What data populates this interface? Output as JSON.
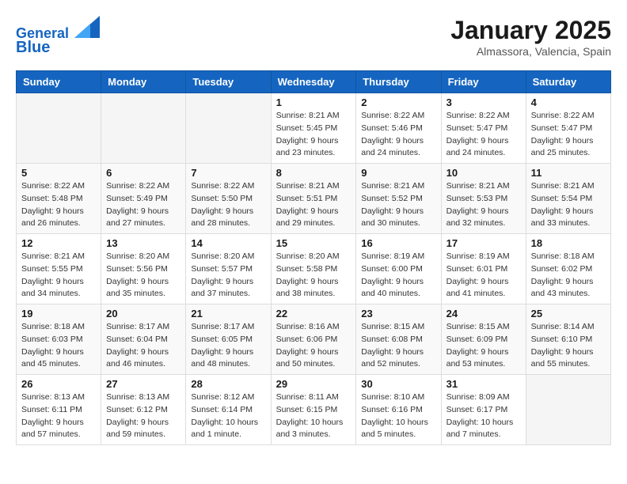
{
  "header": {
    "logo_line1": "General",
    "logo_line2": "Blue",
    "month_title": "January 2025",
    "location": "Almassora, Valencia, Spain"
  },
  "weekdays": [
    "Sunday",
    "Monday",
    "Tuesday",
    "Wednesday",
    "Thursday",
    "Friday",
    "Saturday"
  ],
  "weeks": [
    [
      {
        "day": "",
        "info": ""
      },
      {
        "day": "",
        "info": ""
      },
      {
        "day": "",
        "info": ""
      },
      {
        "day": "1",
        "info": "Sunrise: 8:21 AM\nSunset: 5:45 PM\nDaylight: 9 hours\nand 23 minutes."
      },
      {
        "day": "2",
        "info": "Sunrise: 8:22 AM\nSunset: 5:46 PM\nDaylight: 9 hours\nand 24 minutes."
      },
      {
        "day": "3",
        "info": "Sunrise: 8:22 AM\nSunset: 5:47 PM\nDaylight: 9 hours\nand 24 minutes."
      },
      {
        "day": "4",
        "info": "Sunrise: 8:22 AM\nSunset: 5:47 PM\nDaylight: 9 hours\nand 25 minutes."
      }
    ],
    [
      {
        "day": "5",
        "info": "Sunrise: 8:22 AM\nSunset: 5:48 PM\nDaylight: 9 hours\nand 26 minutes."
      },
      {
        "day": "6",
        "info": "Sunrise: 8:22 AM\nSunset: 5:49 PM\nDaylight: 9 hours\nand 27 minutes."
      },
      {
        "day": "7",
        "info": "Sunrise: 8:22 AM\nSunset: 5:50 PM\nDaylight: 9 hours\nand 28 minutes."
      },
      {
        "day": "8",
        "info": "Sunrise: 8:21 AM\nSunset: 5:51 PM\nDaylight: 9 hours\nand 29 minutes."
      },
      {
        "day": "9",
        "info": "Sunrise: 8:21 AM\nSunset: 5:52 PM\nDaylight: 9 hours\nand 30 minutes."
      },
      {
        "day": "10",
        "info": "Sunrise: 8:21 AM\nSunset: 5:53 PM\nDaylight: 9 hours\nand 32 minutes."
      },
      {
        "day": "11",
        "info": "Sunrise: 8:21 AM\nSunset: 5:54 PM\nDaylight: 9 hours\nand 33 minutes."
      }
    ],
    [
      {
        "day": "12",
        "info": "Sunrise: 8:21 AM\nSunset: 5:55 PM\nDaylight: 9 hours\nand 34 minutes."
      },
      {
        "day": "13",
        "info": "Sunrise: 8:20 AM\nSunset: 5:56 PM\nDaylight: 9 hours\nand 35 minutes."
      },
      {
        "day": "14",
        "info": "Sunrise: 8:20 AM\nSunset: 5:57 PM\nDaylight: 9 hours\nand 37 minutes."
      },
      {
        "day": "15",
        "info": "Sunrise: 8:20 AM\nSunset: 5:58 PM\nDaylight: 9 hours\nand 38 minutes."
      },
      {
        "day": "16",
        "info": "Sunrise: 8:19 AM\nSunset: 6:00 PM\nDaylight: 9 hours\nand 40 minutes."
      },
      {
        "day": "17",
        "info": "Sunrise: 8:19 AM\nSunset: 6:01 PM\nDaylight: 9 hours\nand 41 minutes."
      },
      {
        "day": "18",
        "info": "Sunrise: 8:18 AM\nSunset: 6:02 PM\nDaylight: 9 hours\nand 43 minutes."
      }
    ],
    [
      {
        "day": "19",
        "info": "Sunrise: 8:18 AM\nSunset: 6:03 PM\nDaylight: 9 hours\nand 45 minutes."
      },
      {
        "day": "20",
        "info": "Sunrise: 8:17 AM\nSunset: 6:04 PM\nDaylight: 9 hours\nand 46 minutes."
      },
      {
        "day": "21",
        "info": "Sunrise: 8:17 AM\nSunset: 6:05 PM\nDaylight: 9 hours\nand 48 minutes."
      },
      {
        "day": "22",
        "info": "Sunrise: 8:16 AM\nSunset: 6:06 PM\nDaylight: 9 hours\nand 50 minutes."
      },
      {
        "day": "23",
        "info": "Sunrise: 8:15 AM\nSunset: 6:08 PM\nDaylight: 9 hours\nand 52 minutes."
      },
      {
        "day": "24",
        "info": "Sunrise: 8:15 AM\nSunset: 6:09 PM\nDaylight: 9 hours\nand 53 minutes."
      },
      {
        "day": "25",
        "info": "Sunrise: 8:14 AM\nSunset: 6:10 PM\nDaylight: 9 hours\nand 55 minutes."
      }
    ],
    [
      {
        "day": "26",
        "info": "Sunrise: 8:13 AM\nSunset: 6:11 PM\nDaylight: 9 hours\nand 57 minutes."
      },
      {
        "day": "27",
        "info": "Sunrise: 8:13 AM\nSunset: 6:12 PM\nDaylight: 9 hours\nand 59 minutes."
      },
      {
        "day": "28",
        "info": "Sunrise: 8:12 AM\nSunset: 6:14 PM\nDaylight: 10 hours\nand 1 minute."
      },
      {
        "day": "29",
        "info": "Sunrise: 8:11 AM\nSunset: 6:15 PM\nDaylight: 10 hours\nand 3 minutes."
      },
      {
        "day": "30",
        "info": "Sunrise: 8:10 AM\nSunset: 6:16 PM\nDaylight: 10 hours\nand 5 minutes."
      },
      {
        "day": "31",
        "info": "Sunrise: 8:09 AM\nSunset: 6:17 PM\nDaylight: 10 hours\nand 7 minutes."
      },
      {
        "day": "",
        "info": ""
      }
    ]
  ]
}
